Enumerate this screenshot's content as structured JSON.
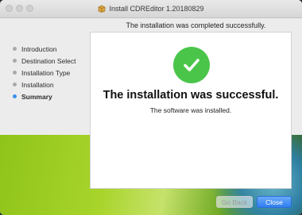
{
  "window": {
    "title": "Install CDREditor 1.20180829"
  },
  "status_line": "The installation was completed successfully.",
  "sidebar": {
    "steps": [
      {
        "label": "Introduction",
        "active": false
      },
      {
        "label": "Destination Select",
        "active": false
      },
      {
        "label": "Installation Type",
        "active": false
      },
      {
        "label": "Installation",
        "active": false
      },
      {
        "label": "Summary",
        "active": true
      }
    ]
  },
  "panel": {
    "heading": "The installation was successful.",
    "subtext": "The software was installed."
  },
  "buttons": {
    "go_back": "Go Back",
    "close": "Close"
  },
  "icons": {
    "title_icon": "package-icon",
    "success_icon": "checkmark-circle-icon"
  },
  "colors": {
    "success": "#4ac54a",
    "accent": "#3b8ff0"
  }
}
